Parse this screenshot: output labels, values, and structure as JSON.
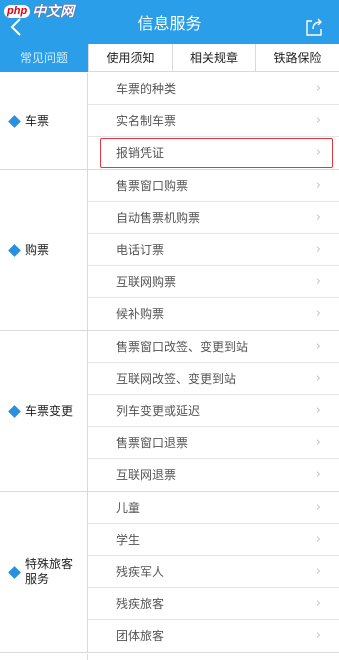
{
  "watermark": {
    "brand": "php",
    "text": "中文网"
  },
  "header": {
    "title": "信息服务",
    "back_icon": "back-arrow-icon",
    "share_icon": "share-icon",
    "bg_color": "#2a9ee8"
  },
  "tabs": [
    {
      "label": "常见问题",
      "active": true
    },
    {
      "label": "使用须知",
      "active": false
    },
    {
      "label": "相关规章",
      "active": false
    },
    {
      "label": "铁路保险",
      "active": false
    }
  ],
  "sections": [
    {
      "category": "车票",
      "items": [
        "车票的种类",
        "实名制车票",
        "报销凭证"
      ]
    },
    {
      "category": "购票",
      "items": [
        "售票窗口购票",
        "自动售票机购票",
        "电话订票",
        "互联网购票",
        "候补购票"
      ]
    },
    {
      "category": "车票变更",
      "items": [
        "售票窗口改签、变更到站",
        "互联网改签、变更到站",
        "列车变更或延迟",
        "售票窗口退票",
        "互联网退票"
      ]
    },
    {
      "category": "特殊旅客服务",
      "items": [
        "儿童",
        "学生",
        "残疾军人",
        "残疾旅客",
        "团体旅客"
      ]
    }
  ],
  "highlighted_item": "报销凭证",
  "chevron_glyph": "›",
  "accent_color": "#2a9ee8",
  "highlight_color": "#e0383e"
}
